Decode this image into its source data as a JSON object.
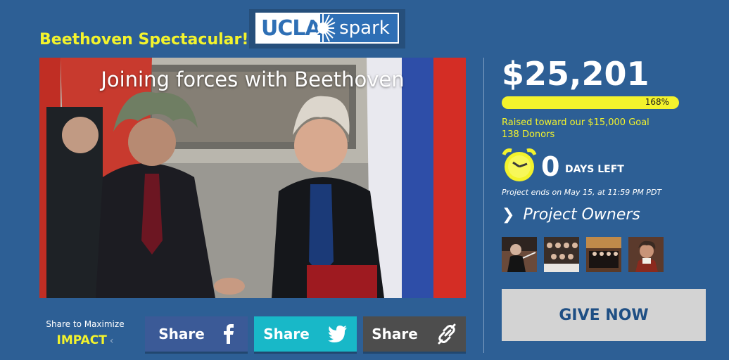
{
  "page": {
    "title": "Beethoven Spectacular!",
    "logo": {
      "left_text": "UCLA",
      "right_text": "spark"
    }
  },
  "video": {
    "caption": "Joining forces with Beethoven"
  },
  "stats": {
    "amount": "$25,201",
    "percent_label": "168%",
    "progress_fraction": 1.0,
    "goal_text": "Raised toward our $15,000 Goal",
    "donors_text": "138 Donors",
    "days_left_number": "0",
    "days_left_label": "DAYS LEFT",
    "ends_text": "Project ends on May 15, at 11:59 PM PDT"
  },
  "owners": {
    "link_label": "Project Owners",
    "thumbnails": [
      {
        "name": "conductor"
      },
      {
        "name": "choir"
      },
      {
        "name": "orchestra"
      },
      {
        "name": "beethoven"
      }
    ]
  },
  "give": {
    "label": "GIVE NOW"
  },
  "share": {
    "line1": "Share to Maximize",
    "line2": "IMPACT",
    "buttons": [
      {
        "label": "Share",
        "icon": "facebook-icon",
        "color": "#3b5a97"
      },
      {
        "label": "Share",
        "icon": "twitter-icon",
        "color": "#18b8c8"
      },
      {
        "label": "Share",
        "icon": "link-icon",
        "color": "#4d4d4d"
      }
    ]
  },
  "colors": {
    "background": "#2d5f95",
    "accent": "#f3f32c",
    "button": "#d3d3d3"
  }
}
